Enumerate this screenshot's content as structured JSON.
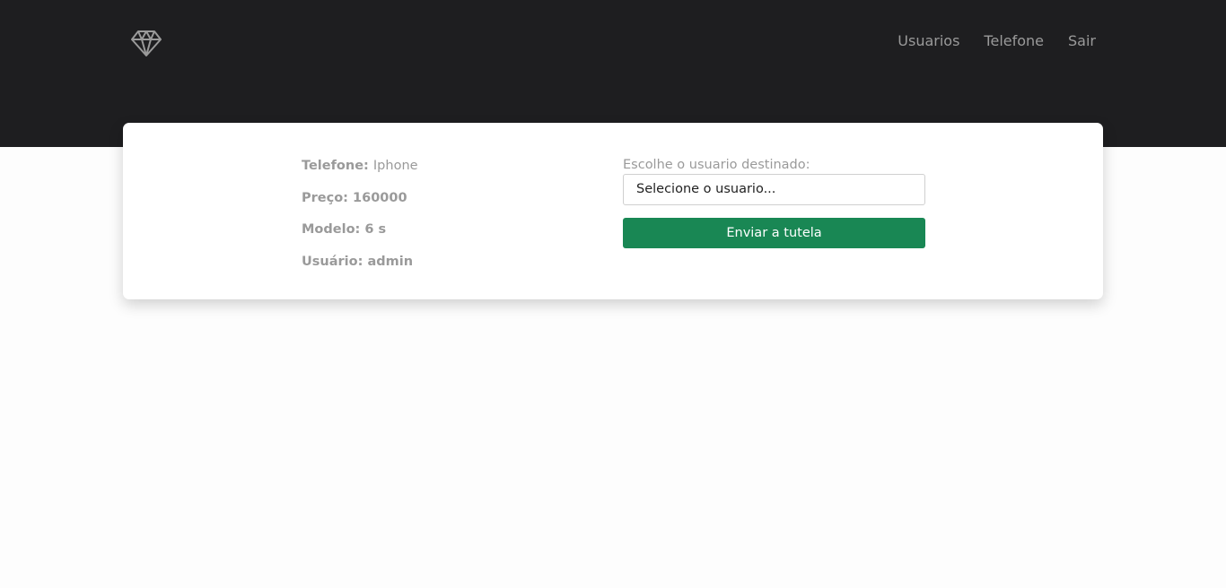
{
  "header": {
    "logo_icon": "diamond-icon",
    "nav": [
      {
        "label": "Usuarios"
      },
      {
        "label": "Telefone"
      },
      {
        "label": "Sair"
      }
    ]
  },
  "phone": {
    "telefone_label": "Telefone:",
    "telefone_value": "Iphone",
    "preco_label": "Preço:",
    "preco_value": "160000",
    "modelo_label": "Modelo:",
    "modelo_value": "6 s",
    "usuario_label": "Usuário:",
    "usuario_value": "admin"
  },
  "form": {
    "select_label": "Escolhe o usuario destinado:",
    "select_value": "Selecione o usuario...",
    "submit_label": "Enviar a tutela"
  },
  "colors": {
    "header_bg": "#1e1e20",
    "button_bg": "#198754",
    "muted_text": "#9a9a9a"
  }
}
